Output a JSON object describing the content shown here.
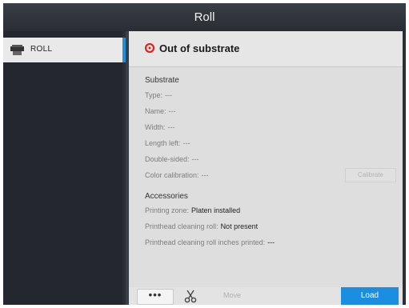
{
  "window": {
    "title": "Roll"
  },
  "sidebar": {
    "items": [
      {
        "label": "ROLL",
        "icon": "roll-icon"
      }
    ]
  },
  "status": {
    "icon": "error-circle-icon",
    "text": "Out of substrate",
    "color": "#e2231a"
  },
  "substrate": {
    "title": "Substrate",
    "rows": [
      {
        "label": "Type:",
        "value": "---"
      },
      {
        "label": "Name:",
        "value": "---"
      },
      {
        "label": "Width:",
        "value": "---"
      },
      {
        "label": "Length left:",
        "value": "---"
      },
      {
        "label": "Double-sided:",
        "value": "---"
      },
      {
        "label": "Color calibration:",
        "value": "---"
      }
    ],
    "calibrate_label": "Calibrate"
  },
  "accessories": {
    "title": "Accessories",
    "rows": [
      {
        "label": "Printing zone:",
        "value": "Platen installed"
      },
      {
        "label": "Printhead cleaning roll:",
        "value": "Not present"
      },
      {
        "label": "Printhead cleaning roll inches printed:",
        "value": "---"
      }
    ]
  },
  "toolbar": {
    "more_label": "•••",
    "cut_icon": "scissors-icon",
    "move_label": "Move",
    "load_label": "Load"
  },
  "colors": {
    "accent": "#1a8ee0",
    "error": "#e2231a"
  }
}
